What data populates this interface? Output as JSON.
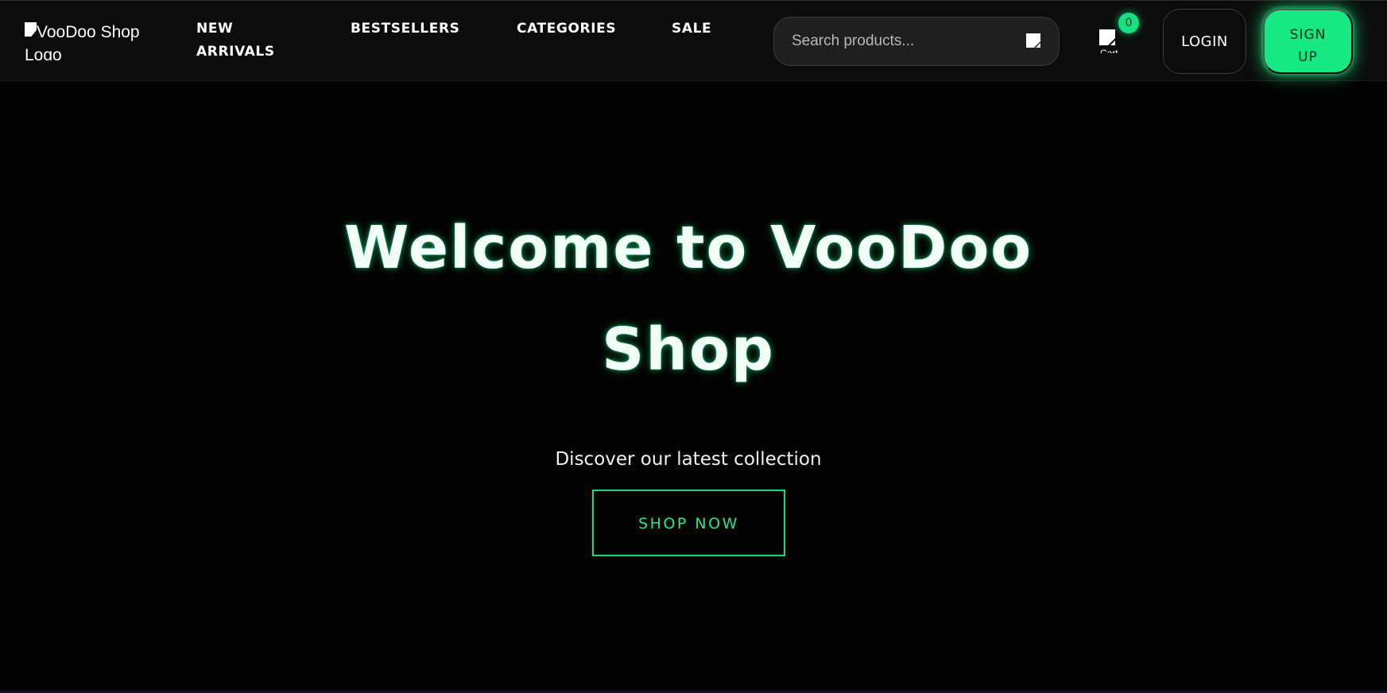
{
  "header": {
    "logo_alt": "VooDoo Shop Logo",
    "nav": {
      "new_arrivals": "NEW ARRIVALS",
      "bestsellers": "BESTSELLERS",
      "categories": "CATEGORIES",
      "sale": "SALE"
    },
    "search": {
      "placeholder": "Search products...",
      "value": "",
      "icon": "search-icon"
    },
    "cart": {
      "icon": "cart-icon",
      "label": "Cart",
      "count": "0"
    },
    "login_label": "LOGIN",
    "signup_label": "SIGN UP"
  },
  "hero": {
    "title": "Welcome to VooDoo Shop",
    "subtitle": "Discover our latest collection",
    "cta_label": "SHOP NOW"
  },
  "colors": {
    "background": "#030303",
    "header_background": "#0c0c0c",
    "accent": "#16e882",
    "text": "#ffffff"
  }
}
